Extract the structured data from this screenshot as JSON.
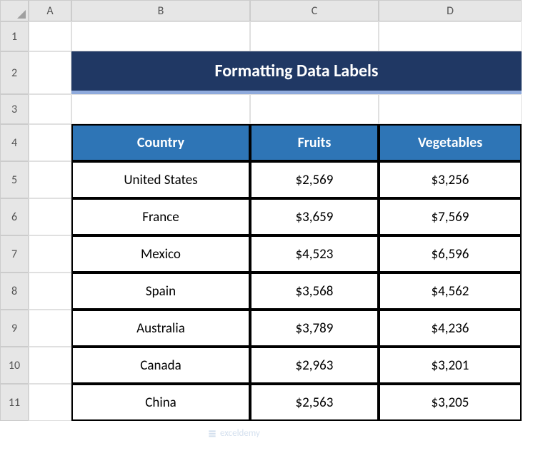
{
  "columns": [
    "A",
    "B",
    "C",
    "D"
  ],
  "rows": [
    "1",
    "2",
    "3",
    "4",
    "5",
    "6",
    "7",
    "8",
    "9",
    "10",
    "11"
  ],
  "title": "Formatting Data Labels",
  "table": {
    "headers": [
      "Country",
      "Fruits",
      "Vegetables"
    ],
    "data": [
      {
        "country": "United States",
        "fruits": "$2,569",
        "vegetables": "$3,256"
      },
      {
        "country": "France",
        "fruits": "$3,659",
        "vegetables": "$7,569"
      },
      {
        "country": "Mexico",
        "fruits": "$4,523",
        "vegetables": "$6,596"
      },
      {
        "country": "Spain",
        "fruits": "$3,568",
        "vegetables": "$4,562"
      },
      {
        "country": "Australia",
        "fruits": "$3,789",
        "vegetables": "$4,236"
      },
      {
        "country": "Canada",
        "fruits": "$2,963",
        "vegetables": "$3,201"
      },
      {
        "country": "China",
        "fruits": "$2,563",
        "vegetables": "$3,205"
      }
    ]
  },
  "watermark": "exceldemy",
  "chart_data": {
    "type": "table",
    "title": "Formatting Data Labels",
    "headers": [
      "Country",
      "Fruits",
      "Vegetables"
    ],
    "rows": [
      [
        "United States",
        2569,
        3256
      ],
      [
        "France",
        3659,
        7569
      ],
      [
        "Mexico",
        4523,
        6596
      ],
      [
        "Spain",
        3568,
        4562
      ],
      [
        "Australia",
        3789,
        4236
      ],
      [
        "Canada",
        2963,
        3201
      ],
      [
        "China",
        2563,
        3205
      ]
    ]
  }
}
